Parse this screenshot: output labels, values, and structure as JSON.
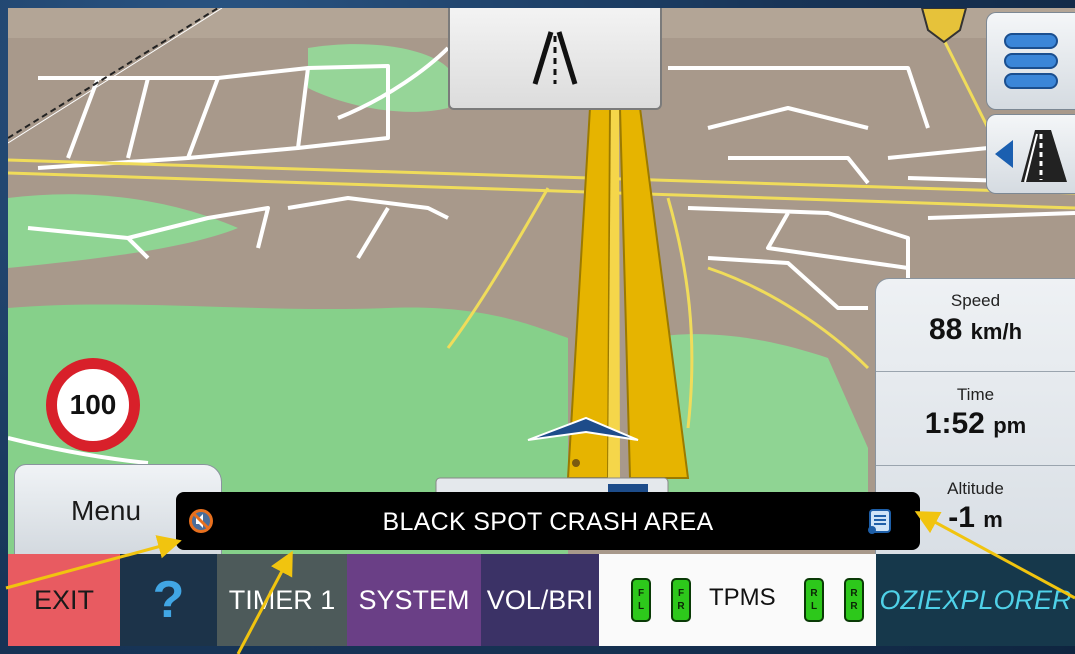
{
  "info_panel": {
    "speed": {
      "label": "Speed",
      "value": "88",
      "unit": "km/h"
    },
    "time": {
      "label": "Time",
      "value": "1:52",
      "unit": "pm"
    },
    "altitude": {
      "label": "Altitude",
      "value": "-1",
      "unit": "m"
    }
  },
  "speed_limit": "100",
  "menu_label": "Menu",
  "alert": {
    "text": "BLACK SPOT CRASH AREA",
    "left_icon": "no-sound-icon",
    "right_icon": "scroll-document-icon"
  },
  "toolbar": {
    "exit": "EXIT",
    "help": "?",
    "timer": "TIMER 1",
    "system": "SYSTEM",
    "vol_bri": "VOL/BRI",
    "tpms": "TPMS",
    "ozi": "OZIEXPLORER",
    "tires": [
      {
        "top": "F",
        "bottom": "L"
      },
      {
        "top": "F",
        "bottom": "R"
      },
      {
        "top": "R",
        "bottom": "L"
      },
      {
        "top": "R",
        "bottom": "R"
      }
    ]
  },
  "colors": {
    "exit_bg": "#e85b61",
    "help_bg": "#1c3349",
    "timer_bg": "#4d5a5a",
    "system_bg": "#6a3f86",
    "vol_bg": "#3b3266",
    "tpms_bg": "#fafafa",
    "ozi_bg": "#16384b",
    "ozi_text": "#4fd1e8",
    "tire_green": "#2dc81b",
    "speed_sign_red": "#d8202a",
    "road_yellow": "#f2c21a",
    "arrow_yellow": "#f1c40f"
  }
}
